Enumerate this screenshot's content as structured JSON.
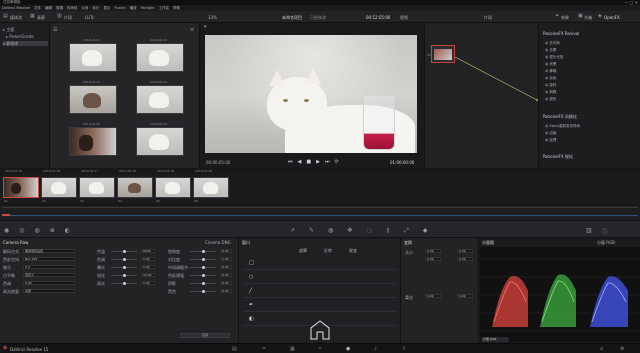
{
  "app": {
    "title": "达芬奇调色",
    "project_title": "未命名项目",
    "edited": "已经修改",
    "status": "DaVinci Resolve 15",
    "version_badge": "15"
  },
  "menu": [
    "DaVinci Resolve",
    "文件",
    "编辑",
    "剪辑",
    "时间线",
    "片段",
    "标记",
    "显示",
    "Fusion",
    "播放",
    "Fairlight",
    "工作区",
    "帮助"
  ],
  "toolbar": {
    "media_pool": "媒体池",
    "gallery": "画廊",
    "timeline_label": "片段",
    "lut": "LUTs",
    "zoom": "33%",
    "timecode": "00:12:55:00",
    "clip_name": "视频",
    "mode": "片段",
    "effects": "效果",
    "lightbox": "光箱",
    "openfx": "OpenFX"
  },
  "mediapool": {
    "items": [
      "主要",
      "PowerGrade",
      "静帧库"
    ]
  },
  "gallery": {
    "thumbs": [
      {
        "label": "2019.00.01",
        "scene": "white"
      },
      {
        "label": "2019.00.02",
        "scene": "white"
      },
      {
        "label": "2019.00.03",
        "scene": "dark"
      },
      {
        "label": "2019.00.04",
        "scene": "white"
      },
      {
        "label": "2019.00.05",
        "scene": "mixed"
      },
      {
        "label": "2019.00.06",
        "scene": "white"
      }
    ]
  },
  "viewer": {
    "timecode": "01:00:00:00",
    "tc_left": "00:00:05:00"
  },
  "fxpanel": {
    "section1": "ResolveFX Revival",
    "items1": [
      "去闪烁",
      "去雾",
      "镜头光斑",
      "光晕",
      "降噪",
      "杂色",
      "染料",
      "刺眼",
      "锐化"
    ],
    "section2": "ResolveFX 风格化",
    "items2": [
      "Xplus重新发布时间",
      "边缘",
      "纹理"
    ],
    "section3": "ResolveFX 锐化"
  },
  "clips": {
    "items": [
      {
        "tc": "2019.02.15",
        "label": "01",
        "scene": "mixed"
      },
      {
        "tc": "2019.02.16",
        "label": "02",
        "scene": "white"
      },
      {
        "tc": "2019.02.17",
        "label": "03",
        "scene": "white"
      },
      {
        "tc": "2019.02.18",
        "label": "04",
        "scene": "dark"
      },
      {
        "tc": "2019.02.19",
        "label": "05",
        "scene": "white"
      },
      {
        "tc": "2019.02.20",
        "label": "06",
        "scene": "white"
      }
    ]
  },
  "camera_raw": {
    "title": "Camera Raw",
    "panel2": "Cinema DNG",
    "rows": [
      {
        "label": "解码方式",
        "value": "使用项目设置"
      },
      {
        "label": "色彩空间",
        "value": "Rec.709"
      },
      {
        "label": "伽马",
        "value": "2.4"
      },
      {
        "label": "白平衡",
        "value": "自定义"
      },
      {
        "label": "色调",
        "value": "0.00"
      },
      {
        "label": "高光恢复",
        "value": "关闭"
      }
    ],
    "mid_rows": [
      {
        "label": "色温",
        "value": "6500"
      },
      {
        "label": "色调",
        "value": "0.00"
      },
      {
        "label": "曝光",
        "value": "0.00"
      },
      {
        "label": "锐化",
        "value": "10.00"
      },
      {
        "label": "高光",
        "value": "0.00"
      }
    ],
    "right_rows": [
      {
        "label": "饱和度",
        "value": "0.00"
      },
      {
        "label": "对比度",
        "value": "1.00"
      },
      {
        "label": "中间调细节",
        "value": "0.00"
      },
      {
        "label": "色彩增强",
        "value": "0.00"
      },
      {
        "label": "阴影",
        "value": "0.00"
      },
      {
        "label": "黑色",
        "value": "0.00"
      }
    ],
    "apply_btn": "应用"
  },
  "window": {
    "title": "窗口",
    "header_left": "遮罩",
    "header_mid": "反转",
    "header_right": "渐变"
  },
  "keys": {
    "title": "变换",
    "row1": "大小",
    "row2": "柔化",
    "vals": [
      "0.00",
      "0.00",
      "0.00",
      "0.00",
      "0.00",
      "0.00"
    ]
  },
  "scopes": {
    "title": "分量图",
    "view": "分量 RGB",
    "values": [
      "0",
      "256",
      "512",
      "768",
      "1023"
    ],
    "badge": "分量 RGB"
  },
  "pagebar": {
    "pages": [
      "媒体",
      "剪切",
      "剪辑",
      "Fusion",
      "调色",
      "Fairlight",
      "交付"
    ]
  }
}
